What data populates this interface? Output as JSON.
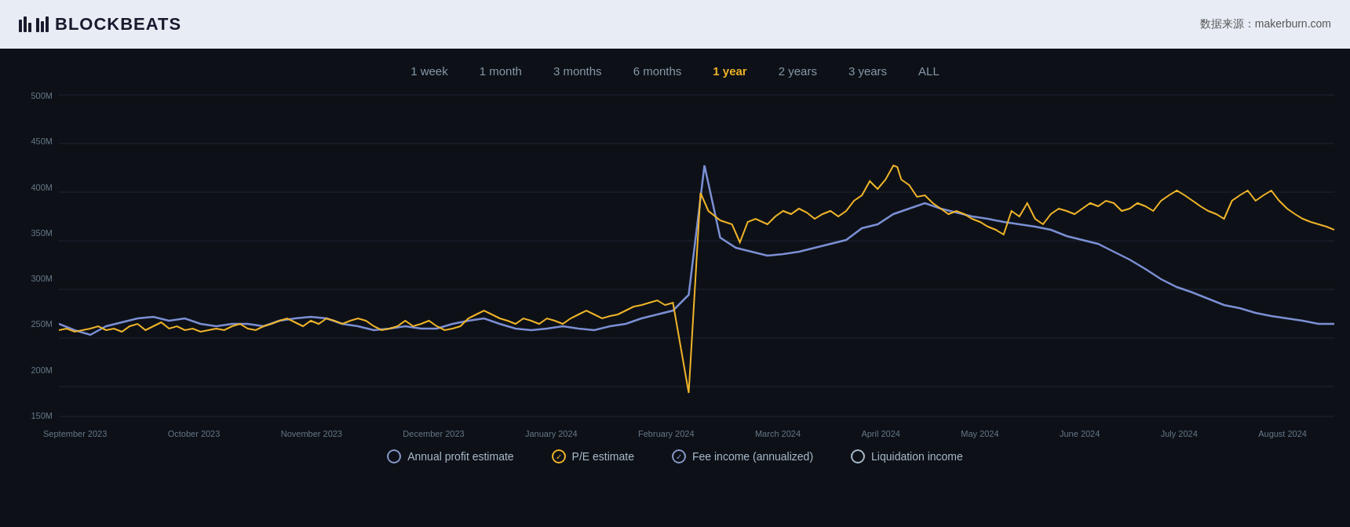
{
  "header": {
    "logo_text": "BLOCKBEATS",
    "data_source": "数据来源：makerburn.com"
  },
  "time_filters": [
    {
      "label": "1 week",
      "id": "1week",
      "active": false
    },
    {
      "label": "1 month",
      "id": "1month",
      "active": false
    },
    {
      "label": "3 months",
      "id": "3months",
      "active": false
    },
    {
      "label": "6 months",
      "id": "6months",
      "active": false
    },
    {
      "label": "1 year",
      "id": "1year",
      "active": true
    },
    {
      "label": "2 years",
      "id": "2years",
      "active": false
    },
    {
      "label": "3 years",
      "id": "3years",
      "active": false
    },
    {
      "label": "ALL",
      "id": "all",
      "active": false
    }
  ],
  "y_axis": [
    "500M",
    "450M",
    "400M",
    "350M",
    "300M",
    "250M",
    "200M",
    "150M"
  ],
  "x_axis": [
    "September 2023",
    "October 2023",
    "November 2023",
    "December 2023",
    "January 2024",
    "February 2024",
    "March 2024",
    "April 2024",
    "May 2024",
    "June 2024",
    "July 2024",
    "August 2024"
  ],
  "legend": [
    {
      "label": "Annual profit estimate",
      "type": "circle",
      "color": "#8899cc"
    },
    {
      "label": "P/E estimate",
      "type": "check",
      "color": "#f0b429"
    },
    {
      "label": "Fee income (annualized)",
      "type": "check",
      "color": "#8899cc"
    },
    {
      "label": "Liquidation income",
      "type": "circle",
      "color": "#aabbcc"
    }
  ],
  "colors": {
    "background": "#0d1117",
    "header_bg": "#e8edf5",
    "logo": "#1a1a2e",
    "active_filter": "#f0b429",
    "inactive_filter": "#8899aa",
    "grid": "#1e2535",
    "purple_line": "#7b8fd4",
    "gold_line": "#f0b429",
    "y_label": "#667788",
    "x_label": "#667788",
    "legend_text": "#aabbcc"
  }
}
